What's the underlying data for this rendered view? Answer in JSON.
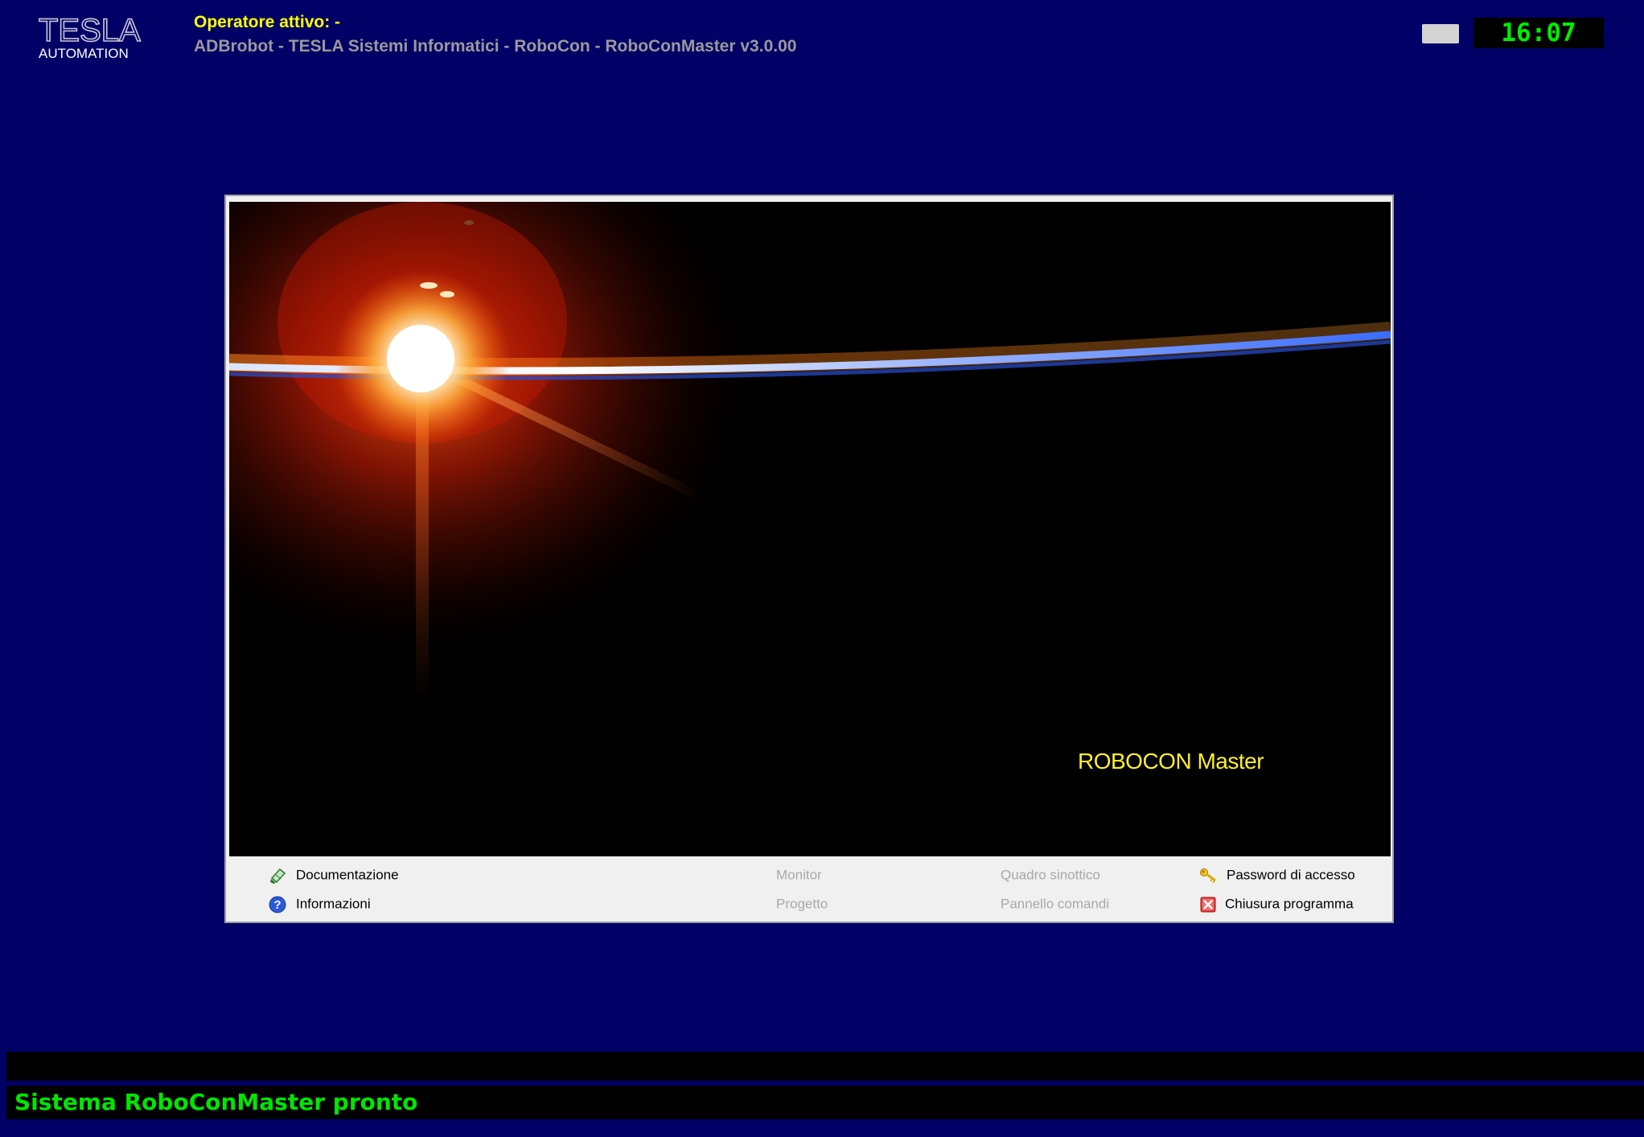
{
  "header": {
    "logo_main": "TESLA",
    "logo_sub": "AUTOMATION",
    "operator": "Operatore attivo: -",
    "app_title": "ADBrobot - TESLA Sistemi Informatici - RoboCon - RoboConMaster v3.0.00",
    "clock": "16:07"
  },
  "splash": {
    "product_name": "ROBOCON Master"
  },
  "menu": {
    "documentazione": "Documentazione",
    "informazioni": "Informazioni",
    "monitor": "Monitor",
    "progetto": "Progetto",
    "quadro_sinottico": "Quadro sinottico",
    "pannello_comandi": "Pannello comandi",
    "password": "Password di accesso",
    "chiusura": "Chiusura programma"
  },
  "menu_state": {
    "monitor": "disabled",
    "progetto": "disabled",
    "quadro_sinottico": "disabled",
    "pannello_comandi": "disabled"
  },
  "icons": {
    "documentazione": "document-icon",
    "informazioni": "help-icon",
    "password": "key-icon",
    "chiusura": "close-icon"
  },
  "status": {
    "message": "Sistema RoboConMaster pronto"
  },
  "colors": {
    "background": "#000066",
    "operator_text": "#ffff00",
    "title_text": "#9a9a9a",
    "clock_text": "#00ee00",
    "status_text": "#00e600",
    "product_name": "#ffef2a"
  }
}
